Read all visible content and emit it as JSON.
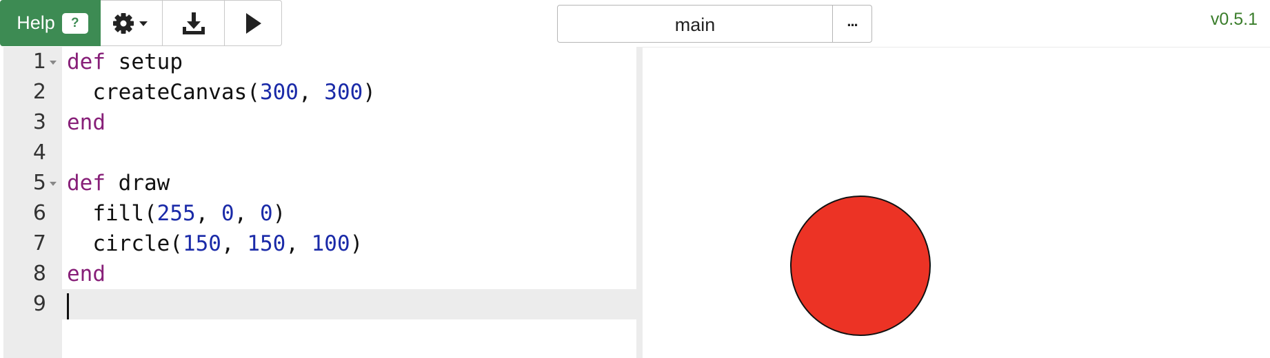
{
  "toolbar": {
    "help_label": "Help",
    "help_badge": "?",
    "icons": [
      "gear-icon",
      "chevron-down-icon",
      "download-icon",
      "play-icon"
    ]
  },
  "file_tab": {
    "name": "main",
    "more_label": "..."
  },
  "version": "v0.5.1",
  "editor": {
    "lines": [
      {
        "num": "1",
        "foldable": true
      },
      {
        "num": "2",
        "foldable": false
      },
      {
        "num": "3",
        "foldable": false
      },
      {
        "num": "4",
        "foldable": false
      },
      {
        "num": "5",
        "foldable": true
      },
      {
        "num": "6",
        "foldable": false
      },
      {
        "num": "7",
        "foldable": false
      },
      {
        "num": "8",
        "foldable": false
      },
      {
        "num": "9",
        "foldable": false,
        "active": true
      }
    ],
    "code": {
      "l1_kw": "def",
      "l1_name": " setup",
      "l2_fn": "  createCanvas(",
      "l2_a": "300",
      "l2_sep": ", ",
      "l2_b": "300",
      "l2_close": ")",
      "l3_kw": "end",
      "l5_kw": "def",
      "l5_name": " draw",
      "l6_fn": "  fill(",
      "l6_a": "255",
      "l6_sep1": ", ",
      "l6_b": "0",
      "l6_sep2": ", ",
      "l6_c": "0",
      "l6_close": ")",
      "l7_fn": "  circle(",
      "l7_a": "150",
      "l7_sep1": ", ",
      "l7_b": "150",
      "l7_sep2": ", ",
      "l7_c": "100",
      "l7_close": ")",
      "l8_kw": "end"
    }
  },
  "colors": {
    "help_green": "#3d8b53",
    "version_green": "#3a7d2b",
    "keyword": "#871f78",
    "number": "#1a2aa8",
    "circle_fill": "#ec3325",
    "circle_stroke": "#111111"
  }
}
